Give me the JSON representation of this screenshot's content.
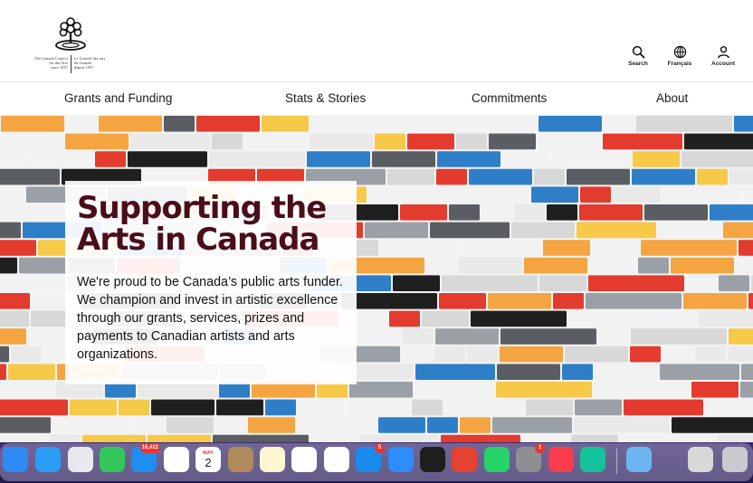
{
  "logo": {
    "text_en": [
      "The Canada Council",
      "for the Arts",
      "since 1957"
    ],
    "text_fr": [
      "Le Conseil des arts",
      "du Canada",
      "depuis 1957"
    ]
  },
  "utility": {
    "search_label": "Search",
    "language_label": "Français",
    "account_label": "Account"
  },
  "nav": {
    "items": [
      "Grants and Funding",
      "Stats & Stories",
      "Commitments",
      "About"
    ]
  },
  "hero": {
    "title_line1": "Supporting the",
    "title_line2": "Arts in Canada",
    "body": "We're proud to be Canada’s public arts funder. We champion and invest in artistic excellence through our grants, services, prizes and payments to Canadian artists and arts organizations."
  },
  "dock": {
    "apps": [
      {
        "name": "finder-icon",
        "color": "#2f8af5"
      },
      {
        "name": "safari-icon",
        "color": "#2a9df4"
      },
      {
        "name": "launchpad-icon",
        "color": "#e8e8ee"
      },
      {
        "name": "messages-icon",
        "color": "#34c759"
      },
      {
        "name": "mail-icon",
        "color": "#1f8ef1",
        "badge": "16,422"
      },
      {
        "name": "photos-icon",
        "color": "#ffffff"
      },
      {
        "name": "calendar-icon",
        "color": "#ffffff",
        "month": "MAY",
        "day": "2"
      },
      {
        "name": "contacts-icon",
        "color": "#b08a5a"
      },
      {
        "name": "notes-icon",
        "color": "#fff7d1"
      },
      {
        "name": "slack-icon",
        "color": "#ffffff"
      },
      {
        "name": "chrome-icon",
        "color": "#ffffff"
      },
      {
        "name": "app-store-icon",
        "color": "#1a8cf0",
        "badge": "5"
      },
      {
        "name": "zoom-icon",
        "color": "#2d8cff"
      },
      {
        "name": "figma-icon",
        "color": "#1e1e1e"
      },
      {
        "name": "todoist-icon",
        "color": "#e44332"
      },
      {
        "name": "whatsapp-icon",
        "color": "#25d366"
      },
      {
        "name": "system-settings-icon",
        "color": "#8e8e93",
        "badge": "1"
      },
      {
        "name": "music-icon",
        "color": "#fa3c4c"
      },
      {
        "name": "grammarly-icon",
        "color": "#15c39a"
      },
      {
        "name": "downloads-folder-icon",
        "color": "#6db4f2"
      },
      {
        "name": "preview-stack-icon",
        "color": "#d8d8d8"
      },
      {
        "name": "trash-icon",
        "color": "#c9c9cf"
      }
    ]
  }
}
